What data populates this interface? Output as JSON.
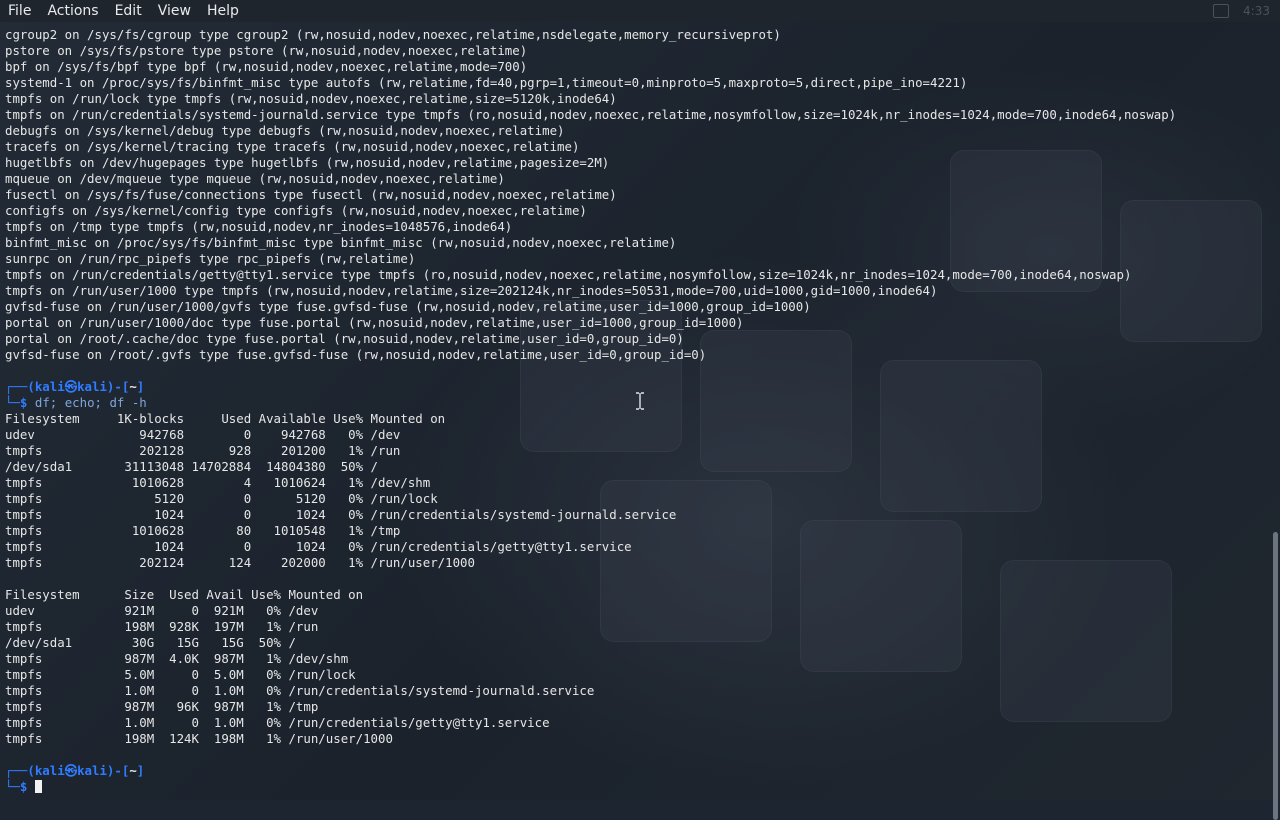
{
  "menubar": {
    "items": [
      "File",
      "Actions",
      "Edit",
      "View",
      "Help"
    ],
    "clock": "4:33"
  },
  "terminal": {
    "mount_output": [
      "cgroup2 on /sys/fs/cgroup type cgroup2 (rw,nosuid,nodev,noexec,relatime,nsdelegate,memory_recursiveprot)",
      "pstore on /sys/fs/pstore type pstore (rw,nosuid,nodev,noexec,relatime)",
      "bpf on /sys/fs/bpf type bpf (rw,nosuid,nodev,noexec,relatime,mode=700)",
      "systemd-1 on /proc/sys/fs/binfmt_misc type autofs (rw,relatime,fd=40,pgrp=1,timeout=0,minproto=5,maxproto=5,direct,pipe_ino=4221)",
      "tmpfs on /run/lock type tmpfs (rw,nosuid,nodev,noexec,relatime,size=5120k,inode64)",
      "tmpfs on /run/credentials/systemd-journald.service type tmpfs (ro,nosuid,nodev,noexec,relatime,nosymfollow,size=1024k,nr_inodes=1024,mode=700,inode64,noswap)",
      "debugfs on /sys/kernel/debug type debugfs (rw,nosuid,nodev,noexec,relatime)",
      "tracefs on /sys/kernel/tracing type tracefs (rw,nosuid,nodev,noexec,relatime)",
      "hugetlbfs on /dev/hugepages type hugetlbfs (rw,nosuid,nodev,relatime,pagesize=2M)",
      "mqueue on /dev/mqueue type mqueue (rw,nosuid,nodev,noexec,relatime)",
      "fusectl on /sys/fs/fuse/connections type fusectl (rw,nosuid,nodev,noexec,relatime)",
      "configfs on /sys/kernel/config type configfs (rw,nosuid,nodev,noexec,relatime)",
      "tmpfs on /tmp type tmpfs (rw,nosuid,nodev,nr_inodes=1048576,inode64)",
      "binfmt_misc on /proc/sys/fs/binfmt_misc type binfmt_misc (rw,nosuid,nodev,noexec,relatime)",
      "sunrpc on /run/rpc_pipefs type rpc_pipefs (rw,relatime)",
      "tmpfs on /run/credentials/getty@tty1.service type tmpfs (ro,nosuid,nodev,noexec,relatime,nosymfollow,size=1024k,nr_inodes=1024,mode=700,inode64,noswap)",
      "tmpfs on /run/user/1000 type tmpfs (rw,nosuid,nodev,relatime,size=202124k,nr_inodes=50531,mode=700,uid=1000,gid=1000,inode64)",
      "gvfsd-fuse on /run/user/1000/gvfs type fuse.gvfsd-fuse (rw,nosuid,nodev,relatime,user_id=1000,group_id=1000)",
      "portal on /run/user/1000/doc type fuse.portal (rw,nosuid,nodev,relatime,user_id=1000,group_id=1000)",
      "portal on /root/.cache/doc type fuse.portal (rw,nosuid,nodev,relatime,user_id=0,group_id=0)",
      "gvfsd-fuse on /root/.gvfs type fuse.gvfsd-fuse (rw,nosuid,nodev,relatime,user_id=0,group_id=0)"
    ],
    "prompt": {
      "top_prefix": "┌──(",
      "user": "kali",
      "at": "㉿",
      "host": "kali",
      "mid": ")-[",
      "cwd": "~",
      "end": "]",
      "bottom_prefix": "└─",
      "dollar": "$"
    },
    "command": "df; echo; df -h",
    "df_output": [
      "Filesystem     1K-blocks     Used Available Use% Mounted on",
      "udev              942768        0    942768   0% /dev",
      "tmpfs             202128      928    201200   1% /run",
      "/dev/sda1       31113048 14702884  14804380  50% /",
      "tmpfs            1010628        4   1010624   1% /dev/shm",
      "tmpfs               5120        0      5120   0% /run/lock",
      "tmpfs               1024        0      1024   0% /run/credentials/systemd-journald.service",
      "tmpfs            1010628       80   1010548   1% /tmp",
      "tmpfs               1024        0      1024   0% /run/credentials/getty@tty1.service",
      "tmpfs             202124      124    202000   1% /run/user/1000"
    ],
    "df_h_output": [
      "Filesystem      Size  Used Avail Use% Mounted on",
      "udev            921M     0  921M   0% /dev",
      "tmpfs           198M  928K  197M   1% /run",
      "/dev/sda1        30G   15G   15G  50% /",
      "tmpfs           987M  4.0K  987M   1% /dev/shm",
      "tmpfs           5.0M     0  5.0M   0% /run/lock",
      "tmpfs           1.0M     0  1.0M   0% /run/credentials/systemd-journald.service",
      "tmpfs           987M   96K  987M   1% /tmp",
      "tmpfs           1.0M     0  1.0M   0% /run/credentials/getty@tty1.service",
      "tmpfs           198M  124K  198M   1% /run/user/1000"
    ]
  },
  "colors": {
    "background": "#1d2530",
    "text": "#e6e6e6",
    "prompt_blue": "#2f7cff",
    "command": "#7fa6d9"
  }
}
